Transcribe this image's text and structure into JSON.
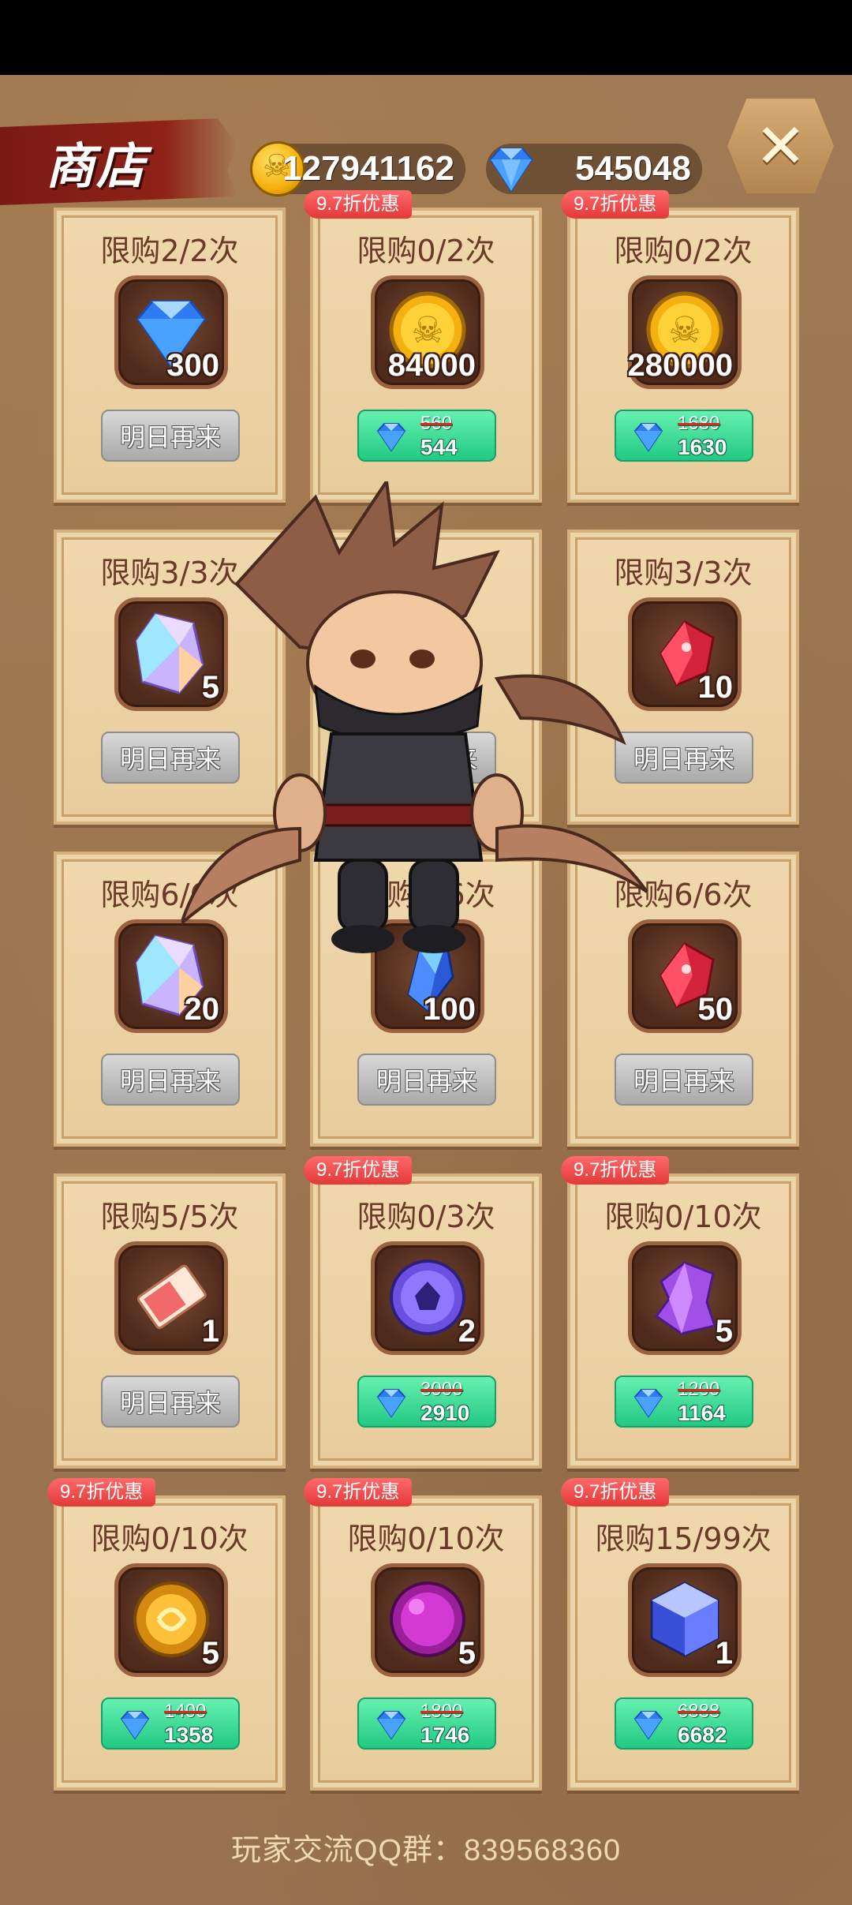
{
  "header": {
    "title": "商店",
    "gold": "127941162",
    "gems": "545048",
    "close_icon": "close-x-icon"
  },
  "cards": [
    {
      "limit": "限购2/2次",
      "qty": "300",
      "item": "diamond",
      "button": "明日再来",
      "badge": "",
      "price_old": "",
      "price_new": ""
    },
    {
      "limit": "限购0/2次",
      "qty": "84000",
      "item": "gold-coin",
      "button": "",
      "badge": "9.7折优惠",
      "price_old": "560",
      "price_new": "544"
    },
    {
      "limit": "限购0/2次",
      "qty": "280000",
      "item": "gold-coin",
      "button": "",
      "badge": "9.7折优惠",
      "price_old": "1680",
      "price_new": "1630"
    },
    {
      "limit": "限购3/3次",
      "qty": "5",
      "item": "rainbow-crystal",
      "button": "明日再来",
      "badge": "",
      "price_old": "",
      "price_new": ""
    },
    {
      "limit": "",
      "qty": "",
      "item": "",
      "button": "明日再来",
      "badge": "",
      "price_old": "",
      "price_new": ""
    },
    {
      "limit": "限购3/3次",
      "qty": "10",
      "item": "red-crystal",
      "button": "明日再来",
      "badge": "",
      "price_old": "",
      "price_new": ""
    },
    {
      "limit": "限购6/6次",
      "qty": "20",
      "item": "rainbow-crystal",
      "button": "明日再来",
      "badge": "",
      "price_old": "",
      "price_new": ""
    },
    {
      "limit": "限购6/6次",
      "qty": "100",
      "item": "blue-crystal",
      "button": "明日再来",
      "badge": "",
      "price_old": "",
      "price_new": ""
    },
    {
      "limit": "限购6/6次",
      "qty": "50",
      "item": "red-crystal",
      "button": "明日再来",
      "badge": "",
      "price_old": "",
      "price_new": ""
    },
    {
      "limit": "限购5/5次",
      "qty": "1",
      "item": "pink-ticket",
      "button": "明日再来",
      "badge": "",
      "price_old": "",
      "price_new": ""
    },
    {
      "limit": "限购0/3次",
      "qty": "2",
      "item": "purple-orb",
      "button": "",
      "badge": "9.7折优惠",
      "price_old": "3000",
      "price_new": "2910"
    },
    {
      "limit": "限购0/10次",
      "qty": "5",
      "item": "purple-shard",
      "button": "",
      "badge": "9.7折优惠",
      "price_old": "1200",
      "price_new": "1164"
    },
    {
      "limit": "限购0/10次",
      "qty": "5",
      "item": "gold-orb",
      "button": "",
      "badge": "9.7折优惠",
      "price_old": "1400",
      "price_new": "1358"
    },
    {
      "limit": "限购0/10次",
      "qty": "5",
      "item": "magenta-orb",
      "button": "",
      "badge": "9.7折优惠",
      "price_old": "1800",
      "price_new": "1746"
    },
    {
      "limit": "限购15/99次",
      "qty": "1",
      "item": "blue-cube",
      "button": "",
      "badge": "9.7折优惠",
      "price_old": "6888",
      "price_new": "6682"
    }
  ],
  "footer": "玩家交流QQ群：839568360",
  "colors": {
    "accent_green": "#22c983",
    "badge_red": "#e23838",
    "title_red": "#8f2219",
    "parchment": "#f0d8ad"
  }
}
